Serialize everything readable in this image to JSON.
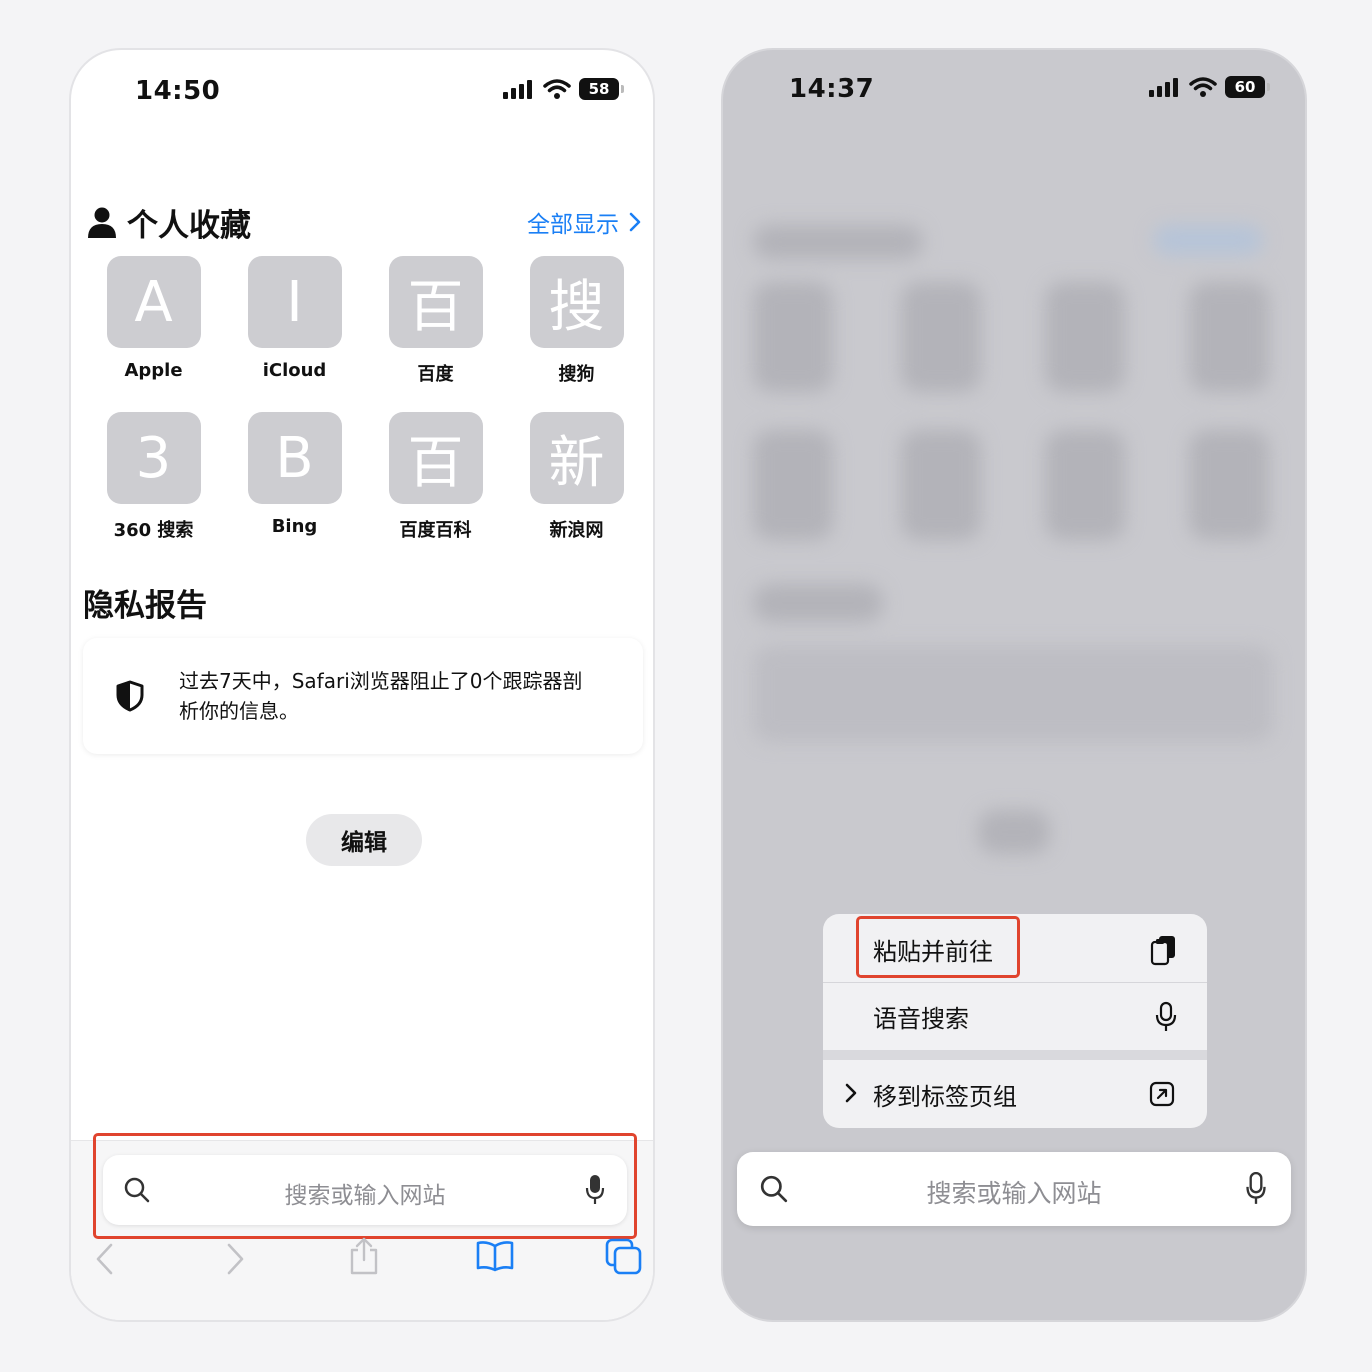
{
  "left_phone": {
    "status": {
      "time": "14:50",
      "battery": "58"
    },
    "favorites": {
      "title": "个人收藏",
      "show_all": "全部显示",
      "items": [
        {
          "letter": "A",
          "label": "Apple"
        },
        {
          "letter": "I",
          "label": "iCloud"
        },
        {
          "letter": "百",
          "label": "百度"
        },
        {
          "letter": "搜",
          "label": "搜狗"
        },
        {
          "letter": "3",
          "label": "360 搜索"
        },
        {
          "letter": "B",
          "label": "Bing"
        },
        {
          "letter": "百",
          "label": "百度百科"
        },
        {
          "letter": "新",
          "label": "新浪网"
        }
      ]
    },
    "privacy": {
      "title": "隐私报告",
      "text": "过去7天中，Safari浏览器阻止了0个跟踪器剖析你的信息。"
    },
    "edit_label": "编辑",
    "search": {
      "placeholder": "搜索或输入网站"
    },
    "toolbar": [
      "back-icon",
      "forward-icon",
      "share-icon",
      "bookmarks-icon",
      "tabs-icon"
    ],
    "colors": {
      "accent": "#1a7ff5",
      "highlight": "#e0442e"
    }
  },
  "right_phone": {
    "status": {
      "time": "14:37",
      "battery": "60"
    },
    "menu": {
      "items": [
        {
          "label": "粘贴并前往",
          "icon": "paste-icon"
        },
        {
          "label": "语音搜索",
          "icon": "microphone-icon"
        },
        {
          "label": "移到标签页组",
          "icon": "move-to-icon"
        }
      ]
    },
    "search": {
      "placeholder": "搜索或输入网站"
    }
  }
}
